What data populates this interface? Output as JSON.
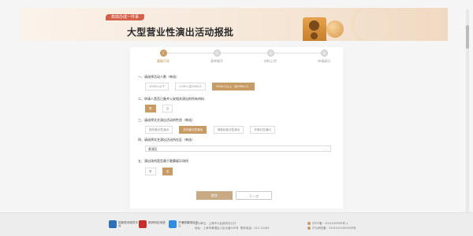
{
  "banner": {
    "tag": "高效办成一件事",
    "title": "大型营业性演出活动报批"
  },
  "steps": [
    {
      "num": "1",
      "label": "基础引导"
    },
    {
      "num": "2",
      "label": "表单填写"
    },
    {
      "num": "3",
      "label": "材料上传"
    },
    {
      "num": "4",
      "label": "申请成功"
    }
  ],
  "q1": {
    "text": "一、请选择活动人数（单选）",
    "options": [
      "1000人以下",
      "1000人至5000人",
      "5000人以上（含5000人）"
    ]
  },
  "q2": {
    "text": "二、申请人是否已备齐公安相关演出的所有材料",
    "options": [
      "是",
      "否"
    ]
  },
  "q3": {
    "text": "三、请选择文艺演出活动的性质（单选）",
    "options": [
      "国内营业性演出",
      "涉外营业性演出",
      "港澳台营业性演出",
      "非营业性演出"
    ]
  },
  "q4": {
    "text": "四、请选择文艺演出活动所在区（单选）",
    "selected": "黄浦区"
  },
  "q5": {
    "text": "五、演出场所是否属于歌舞娱乐场所",
    "options": [
      "是",
      "否"
    ]
  },
  "buttons": {
    "prev": "提交",
    "next": "下一步"
  },
  "footer": {
    "logos": [
      "国家政务服务平台",
      "政府网站找错",
      "开通便捷惠民中心"
    ],
    "mid_line1": "主办单位：上海市人民政府办公厅",
    "mid_line2": "地址：上海市黄浦区人民大道200号",
    "mid_tel": "联系电话：021-12345",
    "right_line1": "沪ICP备：2021039399号-1",
    "right_line2": "沪公网安备：31010102005959号"
  }
}
